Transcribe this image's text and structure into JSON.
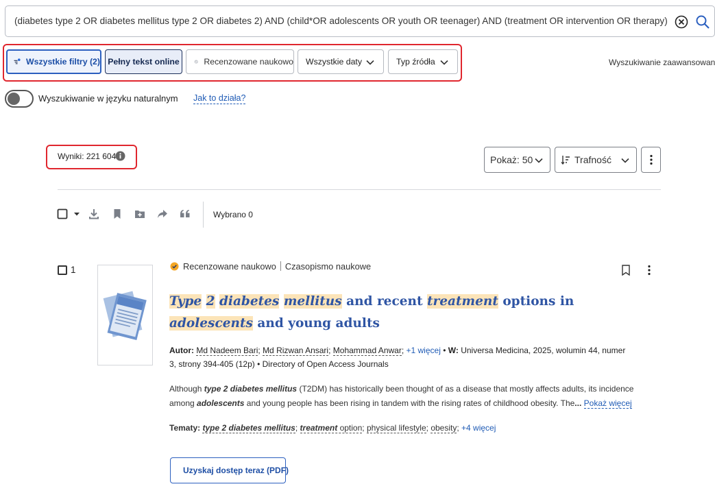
{
  "search": {
    "query": "(diabetes type 2 OR diabetes mellitus type 2 OR diabetes 2) AND (child*OR adolescents OR youth OR teenager) AND (treatment OR intervention OR therapy) I"
  },
  "filters": {
    "all_filters": "Wszystkie filtry (2)",
    "full_text": "Pełny tekst online",
    "peer_reviewed": "Recenzowane naukowo",
    "all_dates": "Wszystkie daty",
    "source_type": "Typ źródła"
  },
  "advanced_search": "Wyszukiwanie zaawansowane",
  "natural_language": {
    "label": "Wyszukiwanie w języku naturalnym",
    "how_link": "Jak to działa?"
  },
  "results": {
    "count_label": "Wyniki: 221 604",
    "show_label": "Pokaż: 50",
    "sort_label": "Trafność",
    "selected_label": "Wybrano 0"
  },
  "result_item": {
    "number": "1",
    "peer_reviewed": "Recenzowane naukowo",
    "source_kind": "Czasopismo naukowe",
    "title_parts": {
      "t1": "Type",
      "t2": "2",
      "t3": "diabetes",
      "t4": "mellitus",
      "t5": "and recent",
      "t6": "treatment",
      "t7": "options in",
      "t8": "adolescents",
      "t9": "and young adults"
    },
    "authors_label": "Autor:",
    "authors": [
      "Md Nadeem Bari",
      "Md Rizwan Ansari",
      "Mohammad Anwar"
    ],
    "authors_more": "+1 więcej",
    "in_label": "W:",
    "source_info": "Universa Medicina, 2025, wolumin 44, numer 3, strony 394-405 (12p)",
    "database": "Directory of Open Access Journals",
    "abstract_1": "Although",
    "abstract_kw1": "type 2 diabetes mellitus",
    "abstract_2": "(T2DM) has historically been thought of as a disease that mostly affects adults, its incidence among",
    "abstract_kw2": "adolescents",
    "abstract_3": "and young people has been rising in tandem with the rising rates of childhood obesity. The",
    "abstract_more": "Pokaż więcej",
    "subjects_label": "Tematy:",
    "subject_1": "type 2 diabetes mellitus",
    "subject_2a": "treatment",
    "subject_2b": "option",
    "subject_3": "physical lifestyle",
    "subject_4": "obesity",
    "subjects_more": "+4 więcej",
    "access_button": "Uzyskaj dostęp teraz (PDF)"
  },
  "colors": {
    "accent": "#2b5fbf",
    "highlight": "#fce4b8",
    "annotation": "#e0262e"
  }
}
